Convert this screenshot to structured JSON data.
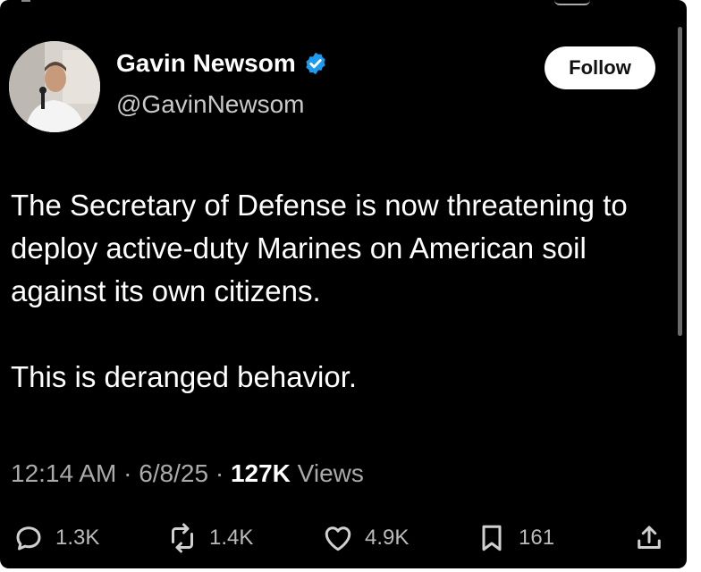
{
  "author": {
    "name": "Gavin Newsom",
    "handle": "@GavinNewsom",
    "verified": true,
    "avatar_icon": "profile-photo"
  },
  "follow_label": "Follow",
  "tweet": {
    "paragraph1": "The Secretary of Defense is now threatening to deploy active-duty Marines on American soil against its own citizens.",
    "paragraph2": "This is deranged behavior."
  },
  "meta": {
    "time": "12:14 AM",
    "date": "6/8/25",
    "views_count": "127K",
    "views_label": "Views",
    "separator": "·"
  },
  "actions": {
    "replies": "1.3K",
    "reposts": "1.4K",
    "likes": "4.9K",
    "bookmarks": "161"
  },
  "colors": {
    "background": "#000000",
    "verified_badge": "#1d9bf0",
    "muted_text": "#aaaaaa"
  }
}
